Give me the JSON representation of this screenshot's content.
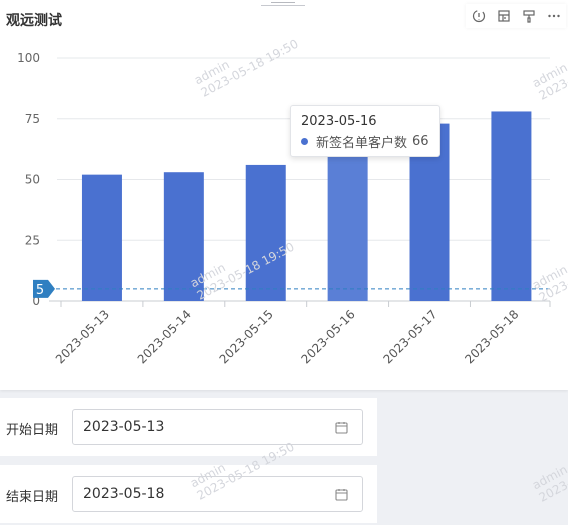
{
  "widget": {
    "title": "观远测试"
  },
  "watermark": {
    "user": "admin",
    "time": "2023-05-18 19:50"
  },
  "chart_data": {
    "type": "bar",
    "categories": [
      "2023-05-13",
      "2023-05-14",
      "2023-05-15",
      "2023-05-16",
      "2023-05-17",
      "2023-05-18"
    ],
    "series": [
      {
        "name": "新签名单客户数",
        "values": [
          52,
          53,
          56,
          66,
          73,
          78
        ],
        "color": "#4a71d0"
      }
    ],
    "ylim": [
      0,
      100
    ],
    "yticks": [
      "100",
      "75",
      "50",
      "25",
      "0"
    ],
    "reference_line": {
      "value": 5,
      "label": "5",
      "color": "#2f7fc1"
    },
    "grid": true
  },
  "tooltip": {
    "title": "2023-05-16",
    "series": "新签名单客户数",
    "value": "66"
  },
  "filters": [
    {
      "label": "开始日期",
      "value": "2023-05-13"
    },
    {
      "label": "结束日期",
      "value": "2023-05-18"
    }
  ]
}
